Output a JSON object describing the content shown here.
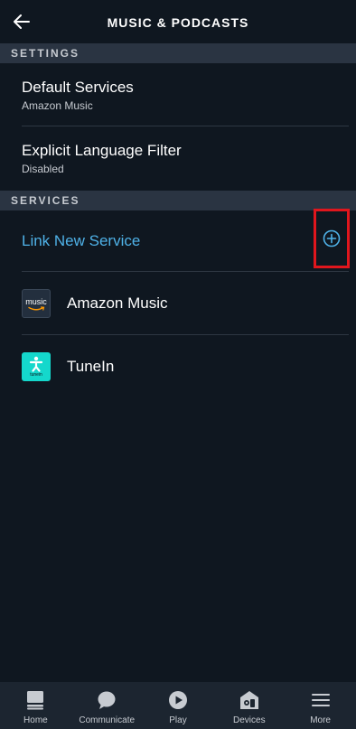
{
  "header": {
    "title": "MUSIC & PODCASTS"
  },
  "sections": {
    "settings_label": "SETTINGS",
    "services_label": "SERVICES"
  },
  "settings": [
    {
      "title": "Default Services",
      "value": "Amazon Music"
    },
    {
      "title": "Explicit Language Filter",
      "value": "Disabled"
    }
  ],
  "link_service": {
    "label": "Link New Service"
  },
  "services": [
    {
      "name": "Amazon Music",
      "logo_text": "music"
    },
    {
      "name": "TuneIn",
      "logo_text": "tunein"
    }
  ],
  "bottom_nav": [
    {
      "label": "Home",
      "icon": "home-icon"
    },
    {
      "label": "Communicate",
      "icon": "chat-bubble-icon"
    },
    {
      "label": "Play",
      "icon": "play-icon"
    },
    {
      "label": "Devices",
      "icon": "devices-icon"
    },
    {
      "label": "More",
      "icon": "menu-icon"
    }
  ],
  "colors": {
    "background": "#0f1720",
    "section_bar": "#2a3442",
    "link_blue": "#4fb2e8",
    "highlight_red": "#e0161d",
    "nav_bar": "#1c2530",
    "tunein_teal": "#14d8cc"
  }
}
